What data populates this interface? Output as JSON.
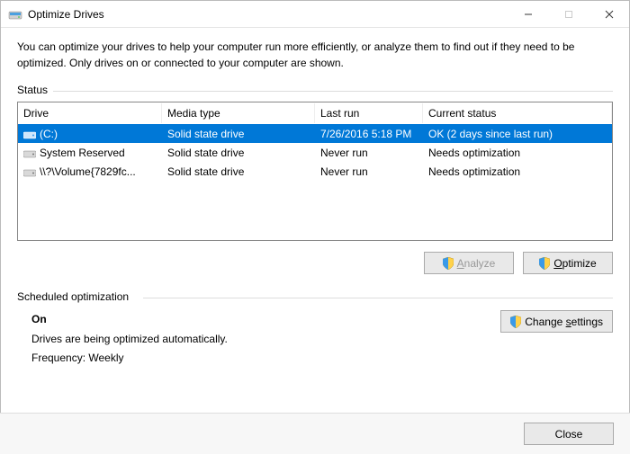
{
  "window": {
    "title": "Optimize Drives"
  },
  "intro": "You can optimize your drives to help your computer run more efficiently, or analyze them to find out if they need to be optimized. Only drives on or connected to your computer are shown.",
  "status": {
    "label": "Status",
    "columns": {
      "drive": "Drive",
      "media": "Media type",
      "last": "Last run",
      "status": "Current status"
    },
    "rows": [
      {
        "drive": "(C:)",
        "media": "Solid state drive",
        "last": "7/26/2016 5:18 PM",
        "status": "OK (2 days since last run)",
        "selected": true,
        "iconColor": "#3a9ae8"
      },
      {
        "drive": "System Reserved",
        "media": "Solid state drive",
        "last": "Never run",
        "status": "Needs optimization",
        "selected": false,
        "iconColor": "#777"
      },
      {
        "drive": "\\\\?\\Volume{7829fc...",
        "media": "Solid state drive",
        "last": "Never run",
        "status": "Needs optimization",
        "selected": false,
        "iconColor": "#777"
      }
    ]
  },
  "buttons": {
    "analyze": "Analyze",
    "optimize": "Optimize",
    "change_settings": "Change settings",
    "close": "Close"
  },
  "scheduled": {
    "label": "Scheduled optimization",
    "state": "On",
    "desc": "Drives are being optimized automatically.",
    "freq": "Frequency: Weekly"
  }
}
